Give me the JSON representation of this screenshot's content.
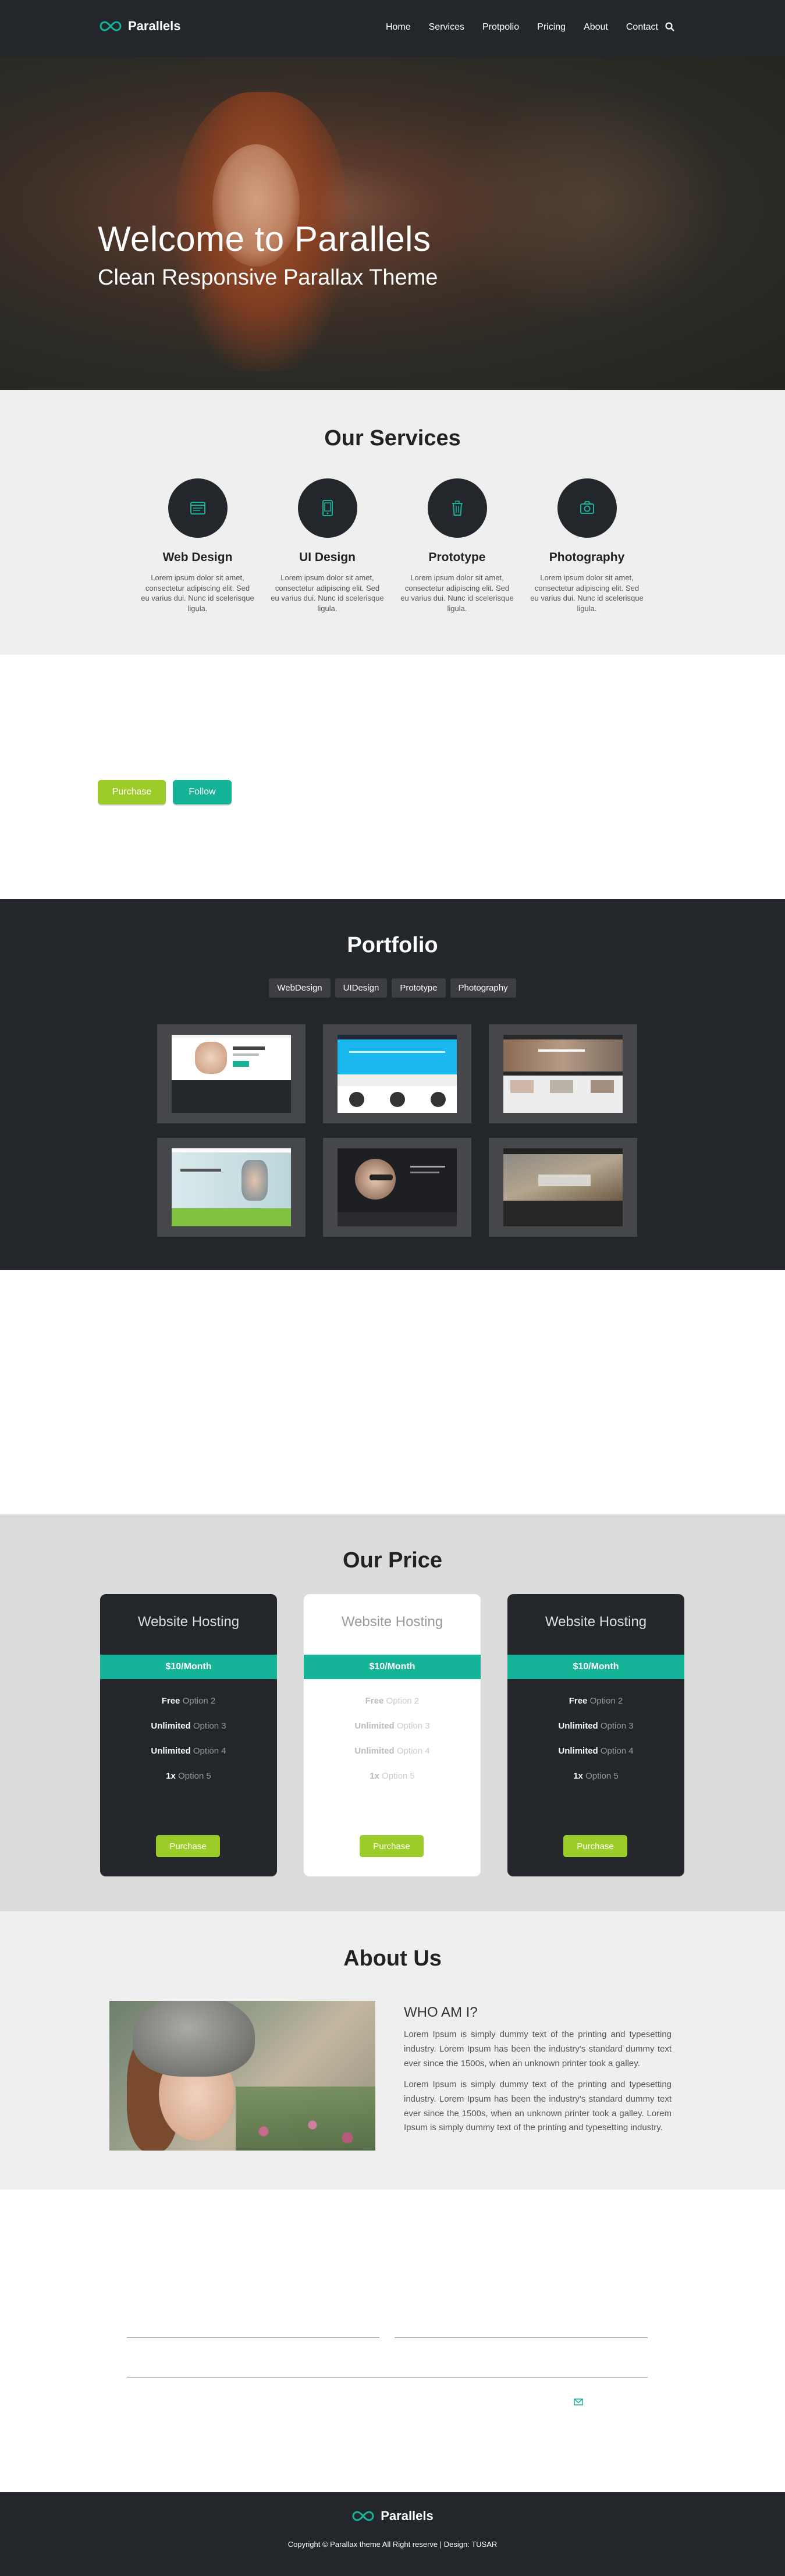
{
  "brand": {
    "name": "Parallels",
    "accent": "#15b398",
    "lime": "#9ccc2a",
    "dark": "#23262b"
  },
  "nav": {
    "items": [
      "Home",
      "Services",
      "Protpolio",
      "Pricing",
      "About",
      "Contact"
    ],
    "search_icon": "search-icon"
  },
  "hero": {
    "title": "Welcome to Parallels",
    "subtitle": "Clean Responsive Parallax Theme"
  },
  "services": {
    "title": "Our Services",
    "items": [
      {
        "title": "Web Design",
        "icon": "browser-window-icon",
        "text": "Lorem ipsum dolor sit amet, consectetur adipiscing elit. Sed eu varius dui. Nunc id scelerisque ligula."
      },
      {
        "title": "UI Design",
        "icon": "tablet-icon",
        "text": "Lorem ipsum dolor sit amet, consectetur adipiscing elit. Sed eu varius dui. Nunc id scelerisque ligula."
      },
      {
        "title": "Prototype",
        "icon": "trash-icon",
        "text": "Lorem ipsum dolor sit amet, consectetur adipiscing elit. Sed eu varius dui. Nunc id scelerisque ligula."
      },
      {
        "title": "Photography",
        "icon": "camera-icon",
        "text": "Lorem ipsum dolor sit amet, consectetur adipiscing elit. Sed eu varius dui. Nunc id scelerisque ligula."
      }
    ]
  },
  "cta": {
    "purchase": "Purchase",
    "follow": "Follow"
  },
  "portfolio": {
    "title": "Portfolio",
    "filters": [
      "WebDesign",
      "UIDesign",
      "Prototype",
      "Photography"
    ]
  },
  "pricing": {
    "title": "Our Price",
    "plans": [
      {
        "name": "Website Hosting",
        "price": "$10/Month",
        "options": [
          [
            "Free",
            "Option 2"
          ],
          [
            "Unlimited",
            "Option 3"
          ],
          [
            "Unlimited",
            "Option 4"
          ],
          [
            "1x",
            "Option 5"
          ]
        ],
        "button": "Purchase"
      },
      {
        "name": "Website Hosting",
        "price": "$10/Month",
        "options": [
          [
            "Free",
            "Option 2"
          ],
          [
            "Unlimited",
            "Option 3"
          ],
          [
            "Unlimited",
            "Option 4"
          ],
          [
            "1x",
            "Option 5"
          ]
        ],
        "button": "Purchase"
      },
      {
        "name": "Website Hosting",
        "price": "$10/Month",
        "options": [
          [
            "Free",
            "Option 2"
          ],
          [
            "Unlimited",
            "Option 3"
          ],
          [
            "Unlimited",
            "Option 4"
          ],
          [
            "1x",
            "Option 5"
          ]
        ],
        "button": "Purchase"
      }
    ]
  },
  "about": {
    "title": "About Us",
    "subtitle": "WHO AM I?",
    "para1": "Lorem Ipsum is simply dummy text of the printing and typesetting industry. Lorem Ipsum has been the industry's standard dummy text ever since the 1500s, when an unknown printer took a galley.",
    "para2": "Lorem Ipsum is simply dummy text of the printing and typesetting industry. Lorem Ipsum has been the industry's standard dummy text ever since the 1500s, when an unknown printer took a galley. Lorem Ipsum is simply dummy text of the printing and typesetting industry."
  },
  "contact": {
    "send_icon": "envelope-icon"
  },
  "footer": {
    "brand": "Parallels",
    "copyright": "Copyright © Parallax theme All Right reserve | Design: TUSAR"
  }
}
